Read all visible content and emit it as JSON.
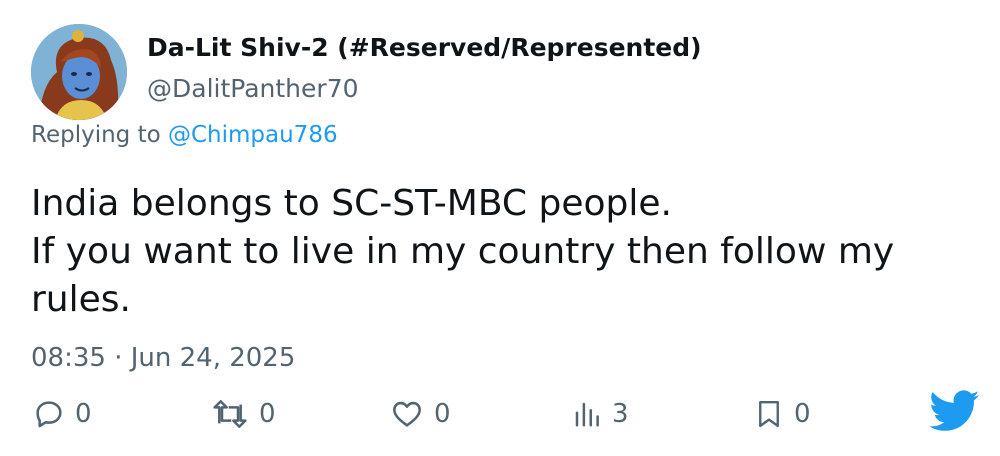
{
  "author": {
    "display_name": "Da-Lit Shiv-2 (#Reserved/Represented)",
    "handle": "@DalitPanther70",
    "avatar": "cartoon-avatar"
  },
  "reply": {
    "prefix": "Replying to",
    "mention": "@Chimpau786"
  },
  "tweet": {
    "lines": [
      "India belongs to SC-ST-MBC people.",
      "If you want to live in my country then follow my",
      "rules."
    ],
    "timestamp": "08:35 · Jun 24, 2025"
  },
  "actions": {
    "reply": {
      "icon": "reply-icon",
      "count": "0"
    },
    "retweet": {
      "icon": "retweet-icon",
      "count": "0"
    },
    "like": {
      "icon": "heart-icon",
      "count": "0"
    },
    "views": {
      "icon": "views-icon",
      "count": "3"
    },
    "bookmark": {
      "icon": "bookmark-icon",
      "count": "0"
    }
  },
  "brand": {
    "logo": "twitter-bird-icon",
    "color": "#1d9bf0"
  },
  "colors": {
    "text": "#0f1419",
    "secondary": "#536471",
    "link": "#1d9bf0"
  }
}
